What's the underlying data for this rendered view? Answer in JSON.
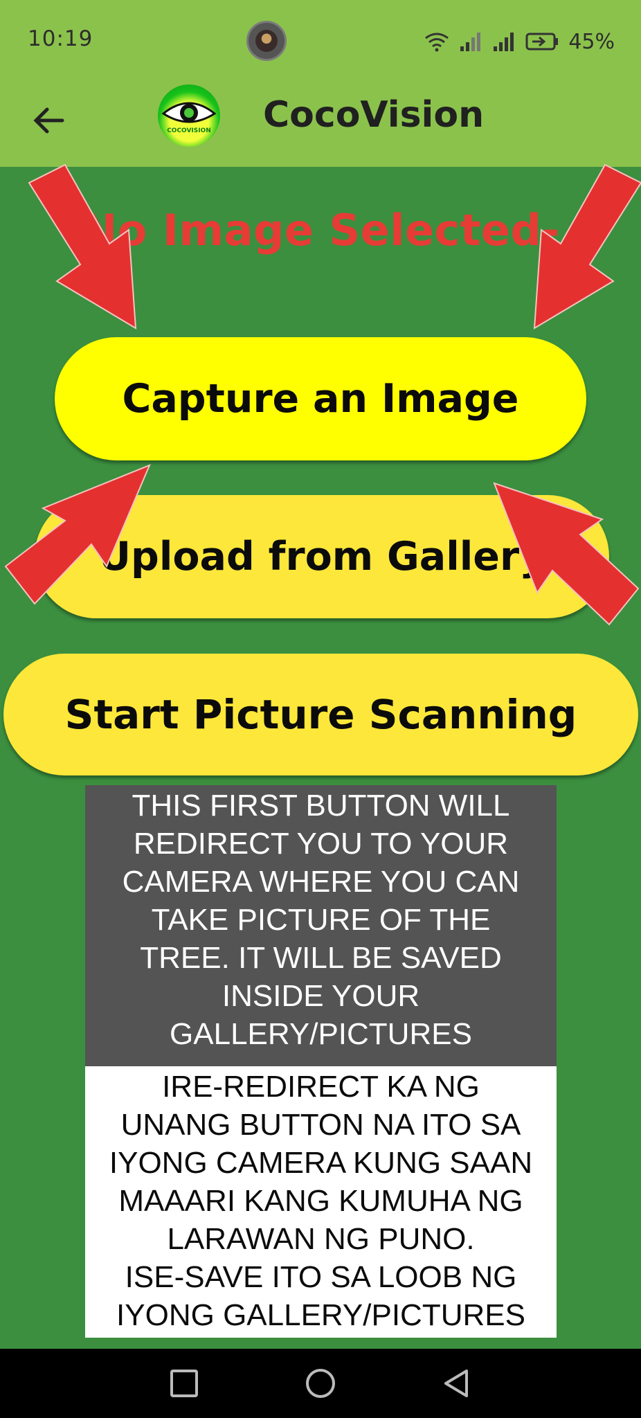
{
  "status_bar": {
    "time": "10:19",
    "battery": "45%",
    "icons": [
      "notification-avatar-icon",
      "wifi-icon",
      "signal-icon",
      "signal-icon",
      "battery-charging-icon"
    ]
  },
  "app_bar": {
    "title": "CocoVision",
    "logo_text": "COCOVISION"
  },
  "main": {
    "status_text": "No Image Selected-",
    "buttons": {
      "capture": "Capture an Image",
      "upload": "Upload from Gallery",
      "scan": "Start Picture Scanning"
    },
    "tips": {
      "english": "THIS FIRST BUTTON WILL\nREDIRECT YOU TO YOUR\nCAMERA WHERE YOU CAN\nTAKE PICTURE OF THE\nTREE. IT WILL BE SAVED\nINSIDE YOUR\nGALLERY/PICTURES",
      "filipino": "IRE-REDIRECT KA NG\nUNANG BUTTON NA ITO SA\nIYONG CAMERA KUNG SAAN\nMAAARI KANG KUMUHA NG\nLARAWAN NG PUNO.\nISE-SAVE ITO SA LOOB NG\nIYONG GALLERY/PICTURES"
    }
  },
  "colors": {
    "background": "#3b8f3f",
    "app_bar": "#8bc24c",
    "status_text": "#e73c36",
    "capture_button": "#ffff00",
    "other_buttons": "#fde73a",
    "arrow": "#e53030"
  },
  "nav_bar": {
    "icons": [
      "recents-square-icon",
      "home-circle-icon",
      "back-triangle-icon"
    ]
  }
}
